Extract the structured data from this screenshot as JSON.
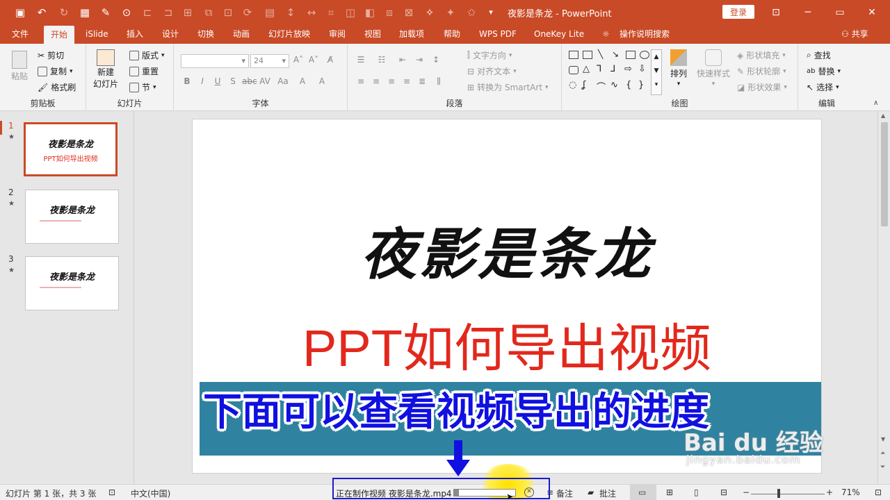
{
  "window": {
    "title": "夜影是条龙 - PowerPoint",
    "login_label": "登录",
    "minimize": "─",
    "restore": "▭",
    "close": "✕",
    "ribbon_display": "⊡"
  },
  "tabs": [
    "文件",
    "开始",
    "iSlide",
    "插入",
    "设计",
    "切换",
    "动画",
    "幻灯片放映",
    "审阅",
    "视图",
    "加载项",
    "帮助",
    "WPS PDF",
    "OneKey Lite"
  ],
  "active_tab": "开始",
  "tell_me": "操作说明搜索",
  "share": "共享",
  "ribbon": {
    "clipboard": {
      "label": "剪贴板",
      "paste": "粘贴",
      "cut": "剪切",
      "copy": "复制",
      "format_painter": "格式刷"
    },
    "slides": {
      "label": "幻灯片",
      "new_slide_1": "新建",
      "new_slide_2": "幻灯片",
      "layout": "版式",
      "reset": "重置",
      "section": "节"
    },
    "font": {
      "label": "字体",
      "size": "24"
    },
    "paragraph": {
      "label": "段落",
      "text_direction": "文字方向",
      "align_text": "对齐文本",
      "smartart": "转换为 SmartArt"
    },
    "drawing": {
      "label": "绘图",
      "arrange": "排列",
      "quick_styles": "快速样式",
      "shape_fill": "形状填充",
      "shape_outline": "形状轮廓",
      "shape_effects": "形状效果"
    },
    "editing": {
      "label": "编辑",
      "find": "查找",
      "replace": "替换",
      "select": "选择"
    }
  },
  "slides": [
    {
      "num": "1",
      "title": "夜影是条龙",
      "subtitle": "PPT如何导出视频",
      "selected": true
    },
    {
      "num": "2",
      "title": "夜影是条龙"
    },
    {
      "num": "3",
      "title": "夜影是条龙"
    }
  ],
  "slide_star": "★",
  "main_slide": {
    "title": "夜影是条龙",
    "subtitle": "PPT如何导出视频",
    "overlay": "下面可以查看视频导出的进度"
  },
  "status": {
    "slide_info": "幻灯片 第 1 张，共 3 张",
    "language": "中文(中国)",
    "progress_label": "正在制作视频 夜影是条龙.mp4",
    "progress": 0.08,
    "notes": "备注",
    "comments": "批注",
    "zoom_minus": "−",
    "zoom_plus": "+",
    "zoom": "71%"
  },
  "watermark": {
    "brand": "Bai du 经验",
    "url": "jingyan.baidu.com"
  },
  "colors": {
    "accent": "#c94a26",
    "slide_subtitle": "#e2281c",
    "overlay_text": "#1010e0",
    "banner": "#2f83a0"
  }
}
